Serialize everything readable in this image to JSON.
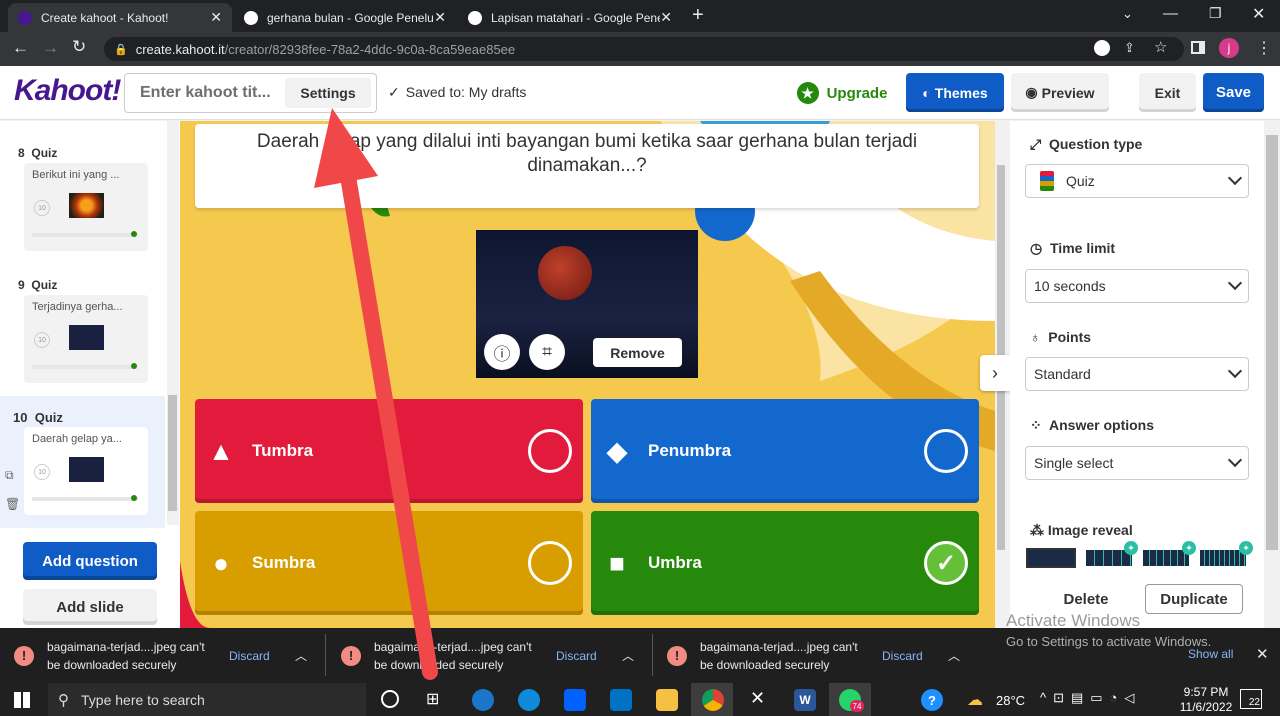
{
  "browser": {
    "tabs": [
      {
        "title": "Create kahoot - Kahoot!",
        "active": true
      },
      {
        "title": "gerhana bulan - Google Penelusu",
        "active": false
      },
      {
        "title": "Lapisan matahari - Google Penel",
        "active": false
      }
    ],
    "url_host": "create.kahoot.it",
    "url_path": "/creator/82938fee-78a2-4ddc-9c0a-8ca59eae85ee",
    "profile_initial": "j"
  },
  "topbar": {
    "logo": "Kahoot!",
    "title_placeholder": "Enter kahoot tit...",
    "settings_label": "Settings",
    "saved_status": "Saved to: My drafts",
    "upgrade_label": "Upgrade",
    "themes_label": "Themes",
    "preview_label": "Preview",
    "exit_label": "Exit",
    "save_label": "Save"
  },
  "sidebar": {
    "slides": [
      {
        "number": "8",
        "type": "Quiz",
        "preview": "Berikut ini yang ...",
        "time": "10"
      },
      {
        "number": "9",
        "type": "Quiz",
        "preview": "Terjadinya gerha...",
        "time": "10"
      },
      {
        "number": "10",
        "type": "Quiz",
        "preview": "Daerah gelap ya...",
        "time": "10"
      }
    ],
    "add_question_label": "Add question",
    "add_slide_label": "Add slide"
  },
  "editor": {
    "question": "Daerah gelap yang dilalui inti bayangan bumi ketika saar gerhana bulan terjadi dinamakan...?",
    "remove_label": "Remove",
    "answers": [
      {
        "text": "Tumbra",
        "color": "#e21b3c",
        "shape": "triangle",
        "correct": false
      },
      {
        "text": "Penumbra",
        "color": "#1368ce",
        "shape": "diamond",
        "correct": false
      },
      {
        "text": "Sumbra",
        "color": "#d89e00",
        "shape": "circle",
        "correct": false
      },
      {
        "text": "Umbra",
        "color": "#26890c",
        "shape": "square",
        "correct": true
      }
    ]
  },
  "settings_panel": {
    "question_type_label": "Question type",
    "question_type_value": "Quiz",
    "time_limit_label": "Time limit",
    "time_limit_value": "10 seconds",
    "points_label": "Points",
    "points_value": "Standard",
    "answer_options_label": "Answer options",
    "answer_options_value": "Single select",
    "image_reveal_label": "Image reveal",
    "delete_label": "Delete",
    "duplicate_label": "Duplicate"
  },
  "watermark": {
    "line1": "Activate Windows",
    "line2": "Go to Settings to activate Windows."
  },
  "downloads": {
    "items": [
      {
        "line1": "bagaimana-terjad....jpeg can't",
        "line2": "be downloaded securely",
        "action": "Discard"
      },
      {
        "line1": "bagaimana-terjad....jpeg can't",
        "line2": "be downloaded securely",
        "action": "Discard"
      },
      {
        "line1": "bagaimana-terjad....jpeg can't",
        "line2": "be downloaded securely",
        "action": "Discard"
      }
    ],
    "show_all_label": "Show all"
  },
  "taskbar": {
    "search_placeholder": "Type here to search",
    "temperature": "28°C",
    "time": "9:57 PM",
    "date": "11/6/2022",
    "notification_count": "22",
    "whatsapp_badge": "74"
  },
  "colors": {
    "kahoot_purple": "#46178f",
    "save_blue": "#0f5cc7",
    "upgrade_green": "#26890c",
    "annotation_arrow": "#f04848"
  }
}
